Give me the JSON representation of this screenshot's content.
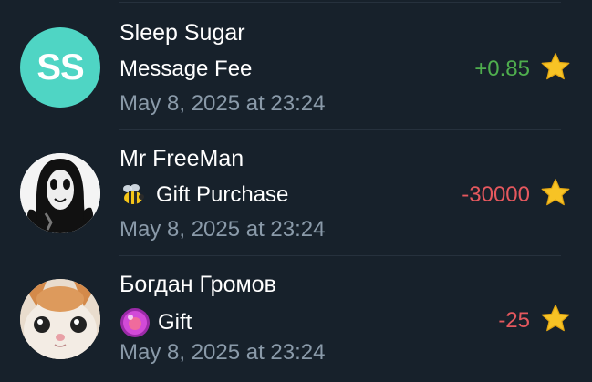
{
  "colors": {
    "background": "#17212b",
    "positive": "#4fae4e",
    "negative": "#e5585e",
    "secondary_text": "#8a9aa9",
    "star": "#f7c325"
  },
  "transactions": [
    {
      "name": "Sleep Sugar",
      "avatar_initials": "SS",
      "avatar_color": "#4fd5c4",
      "description": "Message Fee",
      "description_icon": "",
      "amount": "+0.85",
      "amount_sign": "positive",
      "date": "May 8, 2025 at 23:24"
    },
    {
      "name": "Mr FreeMan",
      "avatar_icon": "ghost-mask-avatar",
      "description": "Gift Purchase",
      "description_icon": "bee-icon",
      "amount": "-30000",
      "amount_sign": "negative",
      "date": "May 8, 2025 at 23:24"
    },
    {
      "name": "Богдан Громов",
      "avatar_icon": "kitten-photo-avatar",
      "description": "Gift",
      "description_icon": "gift-orb-icon",
      "amount": "-25",
      "amount_sign": "negative",
      "date": "May 8, 2025 at 23:24"
    }
  ]
}
